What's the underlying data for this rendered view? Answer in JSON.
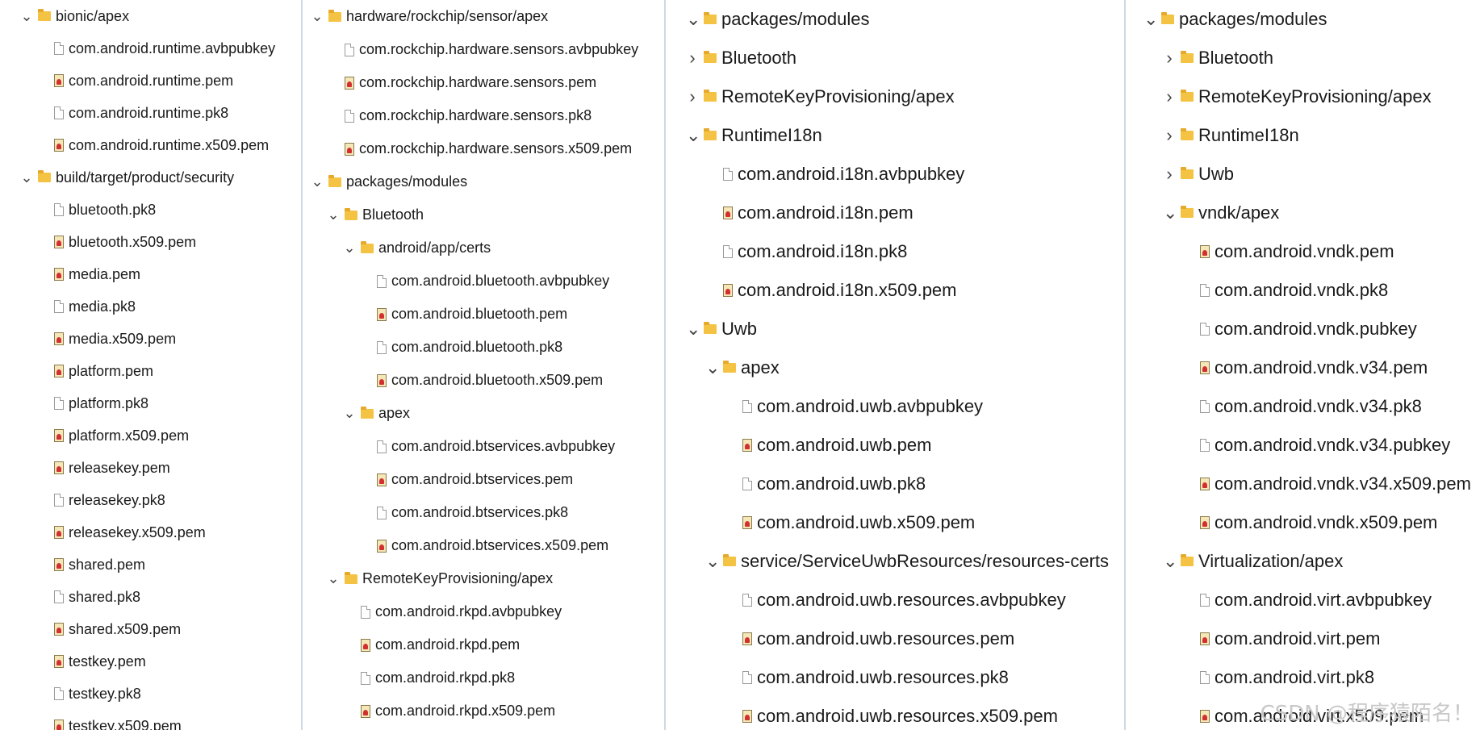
{
  "watermark": "CSDN @程序猿陌名！",
  "panels": [
    {
      "name": "bionic-panel",
      "width": 375,
      "font": 18,
      "rowH": 40,
      "top": 0,
      "indent": 20,
      "baseX": 25,
      "items": [
        {
          "t": "folder",
          "label": "bionic/apex",
          "d": 0,
          "chev": "v"
        },
        {
          "t": "doc",
          "label": "com.android.runtime.avbpubkey",
          "d": 1
        },
        {
          "t": "cert",
          "label": "com.android.runtime.pem",
          "d": 1
        },
        {
          "t": "doc",
          "label": "com.android.runtime.pk8",
          "d": 1
        },
        {
          "t": "cert",
          "label": "com.android.runtime.x509.pem",
          "d": 1
        },
        {
          "t": "folder",
          "label": "build/target/product/security",
          "d": 0,
          "chev": "v"
        },
        {
          "t": "doc",
          "label": "bluetooth.pk8",
          "d": 1
        },
        {
          "t": "cert",
          "label": "bluetooth.x509.pem",
          "d": 1
        },
        {
          "t": "cert",
          "label": "media.pem",
          "d": 1
        },
        {
          "t": "doc",
          "label": "media.pk8",
          "d": 1
        },
        {
          "t": "cert",
          "label": "media.x509.pem",
          "d": 1
        },
        {
          "t": "cert",
          "label": "platform.pem",
          "d": 1
        },
        {
          "t": "doc",
          "label": "platform.pk8",
          "d": 1
        },
        {
          "t": "cert",
          "label": "platform.x509.pem",
          "d": 1
        },
        {
          "t": "cert",
          "label": "releasekey.pem",
          "d": 1
        },
        {
          "t": "doc",
          "label": "releasekey.pk8",
          "d": 1
        },
        {
          "t": "cert",
          "label": "releasekey.x509.pem",
          "d": 1
        },
        {
          "t": "cert",
          "label": "shared.pem",
          "d": 1
        },
        {
          "t": "doc",
          "label": "shared.pk8",
          "d": 1
        },
        {
          "t": "cert",
          "label": "shared.x509.pem",
          "d": 1
        },
        {
          "t": "cert",
          "label": "testkey.pem",
          "d": 1
        },
        {
          "t": "doc",
          "label": "testkey.pk8",
          "d": 1
        },
        {
          "t": "cert",
          "label": "testkey.x509.pem",
          "d": 1
        }
      ]
    },
    {
      "name": "hardware-panel",
      "width": 450,
      "font": 18,
      "rowH": 41,
      "top": 0,
      "indent": 20,
      "baseX": 10,
      "items": [
        {
          "t": "folder",
          "label": "hardware/rockchip/sensor/apex",
          "d": 0,
          "chev": "v"
        },
        {
          "t": "doc",
          "label": "com.rockchip.hardware.sensors.avbpubkey",
          "d": 1
        },
        {
          "t": "cert",
          "label": "com.rockchip.hardware.sensors.pem",
          "d": 1
        },
        {
          "t": "doc",
          "label": "com.rockchip.hardware.sensors.pk8",
          "d": 1
        },
        {
          "t": "cert",
          "label": "com.rockchip.hardware.sensors.x509.pem",
          "d": 1
        },
        {
          "t": "folder",
          "label": "packages/modules",
          "d": 0,
          "chev": "v"
        },
        {
          "t": "folder",
          "label": "Bluetooth",
          "d": 1,
          "chev": "v"
        },
        {
          "t": "folder",
          "label": "android/app/certs",
          "d": 2,
          "chev": "v"
        },
        {
          "t": "doc",
          "label": "com.android.bluetooth.avbpubkey",
          "d": 3
        },
        {
          "t": "cert",
          "label": "com.android.bluetooth.pem",
          "d": 3
        },
        {
          "t": "doc",
          "label": "com.android.bluetooth.pk8",
          "d": 3
        },
        {
          "t": "cert",
          "label": "com.android.bluetooth.x509.pem",
          "d": 3
        },
        {
          "t": "folder",
          "label": "apex",
          "d": 2,
          "chev": "v"
        },
        {
          "t": "doc",
          "label": "com.android.btservices.avbpubkey",
          "d": 3
        },
        {
          "t": "cert",
          "label": "com.android.btservices.pem",
          "d": 3
        },
        {
          "t": "doc",
          "label": "com.android.btservices.pk8",
          "d": 3
        },
        {
          "t": "cert",
          "label": "com.android.btservices.x509.pem",
          "d": 3
        },
        {
          "t": "folder",
          "label": "RemoteKeyProvisioning/apex",
          "d": 1,
          "chev": "v"
        },
        {
          "t": "doc",
          "label": "com.android.rkpd.avbpubkey",
          "d": 2
        },
        {
          "t": "cert",
          "label": "com.android.rkpd.pem",
          "d": 2
        },
        {
          "t": "doc",
          "label": "com.android.rkpd.pk8",
          "d": 2
        },
        {
          "t": "cert",
          "label": "com.android.rkpd.x509.pem",
          "d": 2
        }
      ]
    },
    {
      "name": "packages-panel-a",
      "width": 570,
      "font": 22,
      "rowH": 48,
      "top": 0,
      "indent": 24,
      "baseX": 25,
      "items": [
        {
          "t": "folder",
          "label": "packages/modules",
          "d": 0,
          "chev": "v"
        },
        {
          "t": "folder",
          "label": "Bluetooth",
          "d": 0,
          "chev": ">"
        },
        {
          "t": "folder",
          "label": "RemoteKeyProvisioning/apex",
          "d": 0,
          "chev": ">"
        },
        {
          "t": "folder",
          "label": "RuntimeI18n",
          "d": 0,
          "chev": "v"
        },
        {
          "t": "doc",
          "label": "com.android.i18n.avbpubkey",
          "d": 1
        },
        {
          "t": "cert",
          "label": "com.android.i18n.pem",
          "d": 1
        },
        {
          "t": "doc",
          "label": "com.android.i18n.pk8",
          "d": 1
        },
        {
          "t": "cert",
          "label": "com.android.i18n.x509.pem",
          "d": 1
        },
        {
          "t": "folder",
          "label": "Uwb",
          "d": 0,
          "chev": "v"
        },
        {
          "t": "folder",
          "label": "apex",
          "d": 1,
          "chev": "v"
        },
        {
          "t": "doc",
          "label": "com.android.uwb.avbpubkey",
          "d": 2
        },
        {
          "t": "cert",
          "label": "com.android.uwb.pem",
          "d": 2
        },
        {
          "t": "doc",
          "label": "com.android.uwb.pk8",
          "d": 2
        },
        {
          "t": "cert",
          "label": "com.android.uwb.x509.pem",
          "d": 2
        },
        {
          "t": "folder",
          "label": "service/ServiceUwbResources/resources-certs",
          "d": 1,
          "chev": "v"
        },
        {
          "t": "doc",
          "label": "com.android.uwb.resources.avbpubkey",
          "d": 2
        },
        {
          "t": "cert",
          "label": "com.android.uwb.resources.pem",
          "d": 2
        },
        {
          "t": "doc",
          "label": "com.android.uwb.resources.pk8",
          "d": 2
        },
        {
          "t": "cert",
          "label": "com.android.uwb.resources.x509.pem",
          "d": 2
        }
      ]
    },
    {
      "name": "packages-panel-b",
      "width": 439,
      "font": 22,
      "rowH": 48,
      "top": 0,
      "indent": 24,
      "baseX": 22,
      "items": [
        {
          "t": "folder",
          "label": "packages/modules",
          "d": 0,
          "chev": "v"
        },
        {
          "t": "folder",
          "label": "Bluetooth",
          "d": 1,
          "chev": ">"
        },
        {
          "t": "folder",
          "label": "RemoteKeyProvisioning/apex",
          "d": 1,
          "chev": ">"
        },
        {
          "t": "folder",
          "label": "RuntimeI18n",
          "d": 1,
          "chev": ">"
        },
        {
          "t": "folder",
          "label": "Uwb",
          "d": 1,
          "chev": ">"
        },
        {
          "t": "folder",
          "label": "vndk/apex",
          "d": 1,
          "chev": "v"
        },
        {
          "t": "cert",
          "label": "com.android.vndk.pem",
          "d": 2
        },
        {
          "t": "doc",
          "label": "com.android.vndk.pk8",
          "d": 2
        },
        {
          "t": "doc",
          "label": "com.android.vndk.pubkey",
          "d": 2
        },
        {
          "t": "cert",
          "label": "com.android.vndk.v34.pem",
          "d": 2
        },
        {
          "t": "doc",
          "label": "com.android.vndk.v34.pk8",
          "d": 2
        },
        {
          "t": "doc",
          "label": "com.android.vndk.v34.pubkey",
          "d": 2
        },
        {
          "t": "cert",
          "label": "com.android.vndk.v34.x509.pem",
          "d": 2
        },
        {
          "t": "cert",
          "label": "com.android.vndk.x509.pem",
          "d": 2
        },
        {
          "t": "folder",
          "label": "Virtualization/apex",
          "d": 1,
          "chev": "v"
        },
        {
          "t": "doc",
          "label": "com.android.virt.avbpubkey",
          "d": 2
        },
        {
          "t": "cert",
          "label": "com.android.virt.pem",
          "d": 2
        },
        {
          "t": "doc",
          "label": "com.android.virt.pk8",
          "d": 2
        },
        {
          "t": "cert",
          "label": "com.android.virt.x509.pem",
          "d": 2
        }
      ]
    }
  ]
}
